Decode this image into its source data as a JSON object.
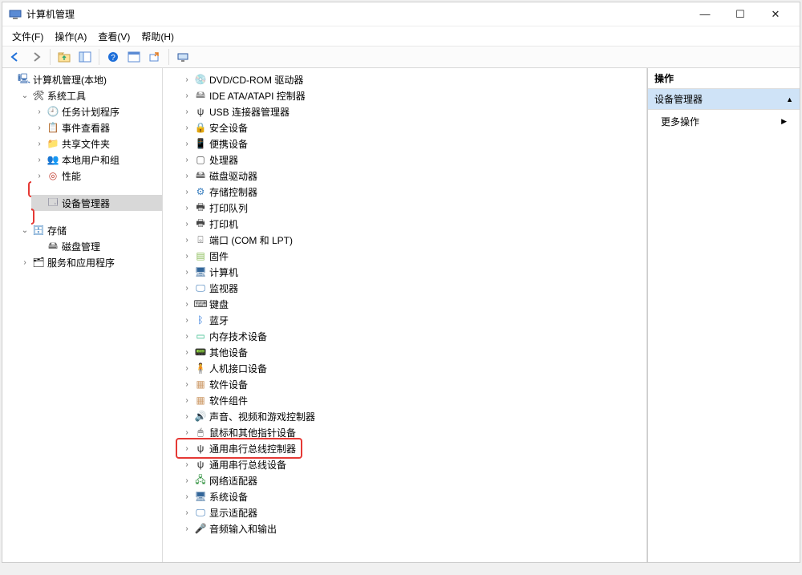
{
  "window": {
    "title": "计算机管理"
  },
  "menu": {
    "file": "文件(F)",
    "action": "操作(A)",
    "view": "查看(V)",
    "help": "帮助(H)"
  },
  "toolbar": {
    "back": "back-icon",
    "forward": "forward-icon",
    "up": "up-folder-icon",
    "props": "properties-icon",
    "help": "help-icon",
    "refresh": "refresh-icon",
    "export": "export-list-icon",
    "showcon": "show-connections-icon"
  },
  "leftTree": {
    "root": "计算机管理(本地)",
    "systools": {
      "label": "系统工具",
      "children": {
        "sched": "任务计划程序",
        "eventvwr": "事件查看器",
        "shared": "共享文件夹",
        "users": "本地用户和组",
        "perf": "性能",
        "devmgr": "设备管理器"
      }
    },
    "storage": {
      "label": "存储",
      "diskmgr": "磁盘管理"
    },
    "services": "服务和应用程序"
  },
  "deviceTree": [
    {
      "icon": "💿",
      "label": "DVD/CD-ROM 驱动器",
      "cls": "ic-drive"
    },
    {
      "icon": "🖴",
      "label": "IDE ATA/ATAPI 控制器",
      "cls": "ic-drive"
    },
    {
      "icon": "ψ",
      "label": "USB 连接器管理器",
      "cls": "ic-usb"
    },
    {
      "icon": "🔒",
      "label": "安全设备",
      "cls": "ic-sec"
    },
    {
      "icon": "📱",
      "label": "便携设备",
      "cls": "ic-hid"
    },
    {
      "icon": "▢",
      "label": "处理器",
      "cls": "ic-cpu"
    },
    {
      "icon": "🖴",
      "label": "磁盘驱动器",
      "cls": "ic-disk"
    },
    {
      "icon": "⚙",
      "label": "存储控制器",
      "cls": "ic-storage"
    },
    {
      "icon": "🖶",
      "label": "打印队列",
      "cls": "ic-printer"
    },
    {
      "icon": "🖶",
      "label": "打印机",
      "cls": "ic-printer"
    },
    {
      "icon": "⌺",
      "label": "端口 (COM 和 LPT)",
      "cls": "ic-port"
    },
    {
      "icon": "▤",
      "label": "固件",
      "cls": "ic-fw"
    },
    {
      "icon": "🖥",
      "label": "计算机",
      "cls": "ic-sys"
    },
    {
      "icon": "🖵",
      "label": "监视器",
      "cls": "ic-monitor"
    },
    {
      "icon": "⌨",
      "label": "键盘",
      "cls": "ic-kb"
    },
    {
      "icon": "ᛒ",
      "label": "蓝牙",
      "cls": "ic-bt"
    },
    {
      "icon": "▭",
      "label": "内存技术设备",
      "cls": "ic-mem"
    },
    {
      "icon": "📟",
      "label": "其他设备",
      "cls": "ic-hid"
    },
    {
      "icon": "🧍",
      "label": "人机接口设备",
      "cls": "ic-hid"
    },
    {
      "icon": "▦",
      "label": "软件设备",
      "cls": "ic-soft"
    },
    {
      "icon": "▦",
      "label": "软件组件",
      "cls": "ic-soft"
    },
    {
      "icon": "🔊",
      "label": "声音、视频和游戏控制器",
      "cls": "ic-sound"
    },
    {
      "icon": "🖱",
      "label": "鼠标和其他指针设备",
      "cls": "ic-mouse"
    },
    {
      "icon": "ψ",
      "label": "通用串行总线控制器",
      "cls": "ic-usb",
      "highlight": true
    },
    {
      "icon": "ψ",
      "label": "通用串行总线设备",
      "cls": "ic-usb"
    },
    {
      "icon": "🖧",
      "label": "网络适配器",
      "cls": "ic-net"
    },
    {
      "icon": "🖥",
      "label": "系统设备",
      "cls": "ic-sys"
    },
    {
      "icon": "🖵",
      "label": "显示适配器",
      "cls": "ic-monitor"
    },
    {
      "icon": "🎤",
      "label": "音频输入和输出",
      "cls": "ic-sound"
    }
  ],
  "actions": {
    "header": "操作",
    "section": "设备管理器",
    "more": "更多操作"
  }
}
